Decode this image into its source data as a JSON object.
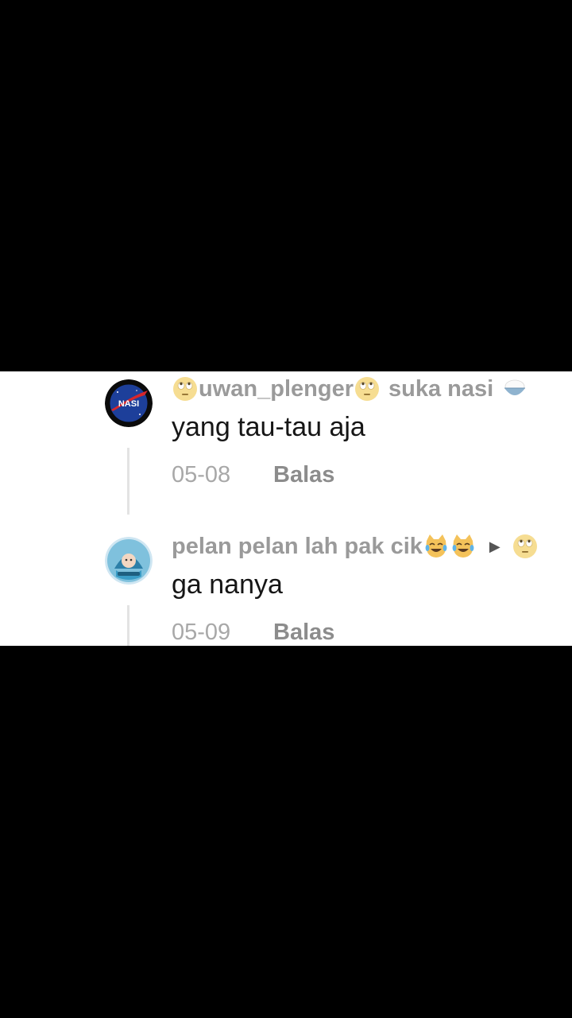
{
  "comments": [
    {
      "username": "uwan_plenger",
      "username_suffix": "suka nasi",
      "text": "yang tau-tau aja",
      "date": "05-08",
      "reply_label": "Balas",
      "avatar_text": "NASI",
      "avatar_icon": "nasa-style-logo"
    },
    {
      "username": "pelan pelan lah pak cik",
      "text": "ga nanya",
      "date": "05-09",
      "reply_label": "Balas",
      "avatar_icon": "character-avatar",
      "reply_to_icon": "eye-roll-emoji"
    }
  ],
  "colors": {
    "username": "#9a9a9a",
    "text": "#161616",
    "date": "#a8a8a8",
    "reply": "#8c8c8c"
  }
}
